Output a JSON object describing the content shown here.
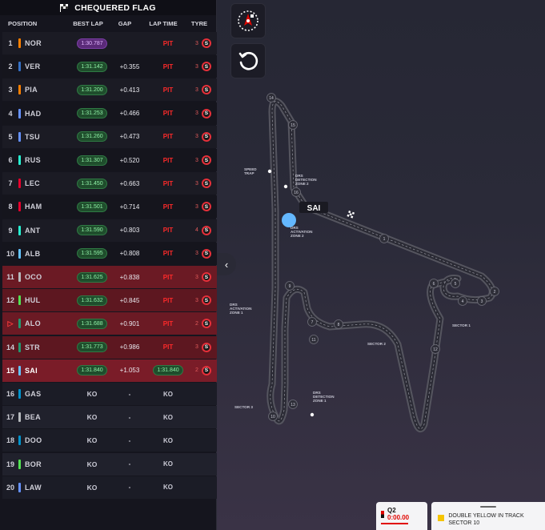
{
  "panel": {
    "header": "CHEQUERED FLAG",
    "columns": {
      "position": "POSITION",
      "best_lap": "BEST LAP",
      "gap": "GAP",
      "lap_time": "LAP TIME",
      "tyre": "TYRE"
    },
    "drivers": [
      {
        "pos": "1",
        "code": "NOR",
        "team_color": "#ff8000",
        "best": "1:30.787",
        "best_fastest": true,
        "gap": "",
        "lap_time": "PIT",
        "tyre_laps": "3",
        "tyre": "S",
        "state": "in"
      },
      {
        "pos": "2",
        "code": "VER",
        "team_color": "#3671c6",
        "best": "1:31.142",
        "gap": "+0.355",
        "lap_time": "PIT",
        "tyre_laps": "3",
        "tyre": "S",
        "state": "in"
      },
      {
        "pos": "3",
        "code": "PIA",
        "team_color": "#ff8000",
        "best": "1:31.200",
        "gap": "+0.413",
        "lap_time": "PIT",
        "tyre_laps": "3",
        "tyre": "S",
        "state": "in"
      },
      {
        "pos": "4",
        "code": "HAD",
        "team_color": "#6692ff",
        "best": "1:31.253",
        "gap": "+0.466",
        "lap_time": "PIT",
        "tyre_laps": "3",
        "tyre": "S",
        "state": "in"
      },
      {
        "pos": "5",
        "code": "TSU",
        "team_color": "#6692ff",
        "best": "1:31.260",
        "gap": "+0.473",
        "lap_time": "PIT",
        "tyre_laps": "3",
        "tyre": "S",
        "state": "in"
      },
      {
        "pos": "6",
        "code": "RUS",
        "team_color": "#27f4d2",
        "best": "1:31.307",
        "gap": "+0.520",
        "lap_time": "PIT",
        "tyre_laps": "3",
        "tyre": "S",
        "state": "in"
      },
      {
        "pos": "7",
        "code": "LEC",
        "team_color": "#e8002d",
        "best": "1:31.450",
        "gap": "+0.663",
        "lap_time": "PIT",
        "tyre_laps": "3",
        "tyre": "S",
        "state": "in"
      },
      {
        "pos": "8",
        "code": "HAM",
        "team_color": "#e8002d",
        "best": "1:31.501",
        "gap": "+0.714",
        "lap_time": "PIT",
        "tyre_laps": "3",
        "tyre": "S",
        "state": "in"
      },
      {
        "pos": "9",
        "code": "ANT",
        "team_color": "#27f4d2",
        "best": "1:31.590",
        "gap": "+0.803",
        "lap_time": "PIT",
        "tyre_laps": "4",
        "tyre": "S",
        "state": "in"
      },
      {
        "pos": "10",
        "code": "ALB",
        "team_color": "#64c4ff",
        "best": "1:31.595",
        "gap": "+0.808",
        "lap_time": "PIT",
        "tyre_laps": "3",
        "tyre": "S",
        "state": "in"
      },
      {
        "pos": "11",
        "code": "OCO",
        "team_color": "#b6babd",
        "best": "1:31.625",
        "gap": "+0.838",
        "lap_time": "PIT",
        "tyre_laps": "3",
        "tyre": "S",
        "state": "elim"
      },
      {
        "pos": "12",
        "code": "HUL",
        "team_color": "#52e252",
        "best": "1:31.632",
        "gap": "+0.845",
        "lap_time": "PIT",
        "tyre_laps": "3",
        "tyre": "S",
        "state": "elim"
      },
      {
        "pos": "",
        "code": "ALO",
        "team_color": "#229971",
        "best": "1:31.688",
        "gap": "+0.901",
        "lap_time": "PIT",
        "tyre_laps": "2",
        "tyre": "S",
        "state": "elim",
        "marker": "▷"
      },
      {
        "pos": "14",
        "code": "STR",
        "team_color": "#229971",
        "best": "1:31.773",
        "gap": "+0.986",
        "lap_time": "PIT",
        "tyre_laps": "3",
        "tyre": "S",
        "state": "elim"
      },
      {
        "pos": "15",
        "code": "SAI",
        "team_color": "#64c4ff",
        "best": "1:31.840",
        "gap": "+1.053",
        "lap_time": "1:31.840",
        "lap_time_pill": true,
        "tyre_laps": "2",
        "tyre": "S",
        "state": "sel"
      },
      {
        "pos": "16",
        "code": "GAS",
        "team_color": "#0093cc",
        "best": "KO",
        "gap": "-",
        "lap_time": "KO",
        "state": "out"
      },
      {
        "pos": "17",
        "code": "BEA",
        "team_color": "#b6babd",
        "best": "KO",
        "gap": "-",
        "lap_time": "KO",
        "state": "out"
      },
      {
        "pos": "18",
        "code": "DOO",
        "team_color": "#0093cc",
        "best": "KO",
        "gap": "-",
        "lap_time": "KO",
        "state": "out"
      },
      {
        "pos": "19",
        "code": "BOR",
        "team_color": "#52e252",
        "best": "KO",
        "gap": "-",
        "lap_time": "KO",
        "state": "out"
      },
      {
        "pos": "20",
        "code": "LAW",
        "team_color": "#6692ff",
        "best": "KO",
        "gap": "-",
        "lap_time": "KO",
        "state": "out"
      }
    ]
  },
  "map": {
    "tools": {
      "compass_icon": "compass-icon",
      "reset_icon": "reset-rotation-icon"
    },
    "car_label": "SAI",
    "labels": {
      "speed_trap": "SPEED\nTRAP",
      "drs_detect_2": "DRS\nDETECTION\nZONE 2",
      "drs_act_2": "DRS\nACTIVATION\nZONE 2",
      "drs_act_1": "DRS\nACTIVATION\nZONE 1",
      "sector_1": "SECTOR 1",
      "sector_2": "SECTOR 2",
      "sector_3": "SECTOR 3",
      "drs_detect_1": "DRS\nDETECTION\nZONE 1"
    },
    "corners": [
      "14",
      "15",
      "16",
      "1",
      "2",
      "3",
      "4",
      "5",
      "6",
      "7",
      "8",
      "9",
      "10",
      "11",
      "12",
      "13"
    ]
  },
  "session_card": {
    "title": "Q2",
    "time": "0:00.00"
  },
  "message_card": {
    "text": "DOUBLE YELLOW IN TRACK SECTOR 10"
  }
}
